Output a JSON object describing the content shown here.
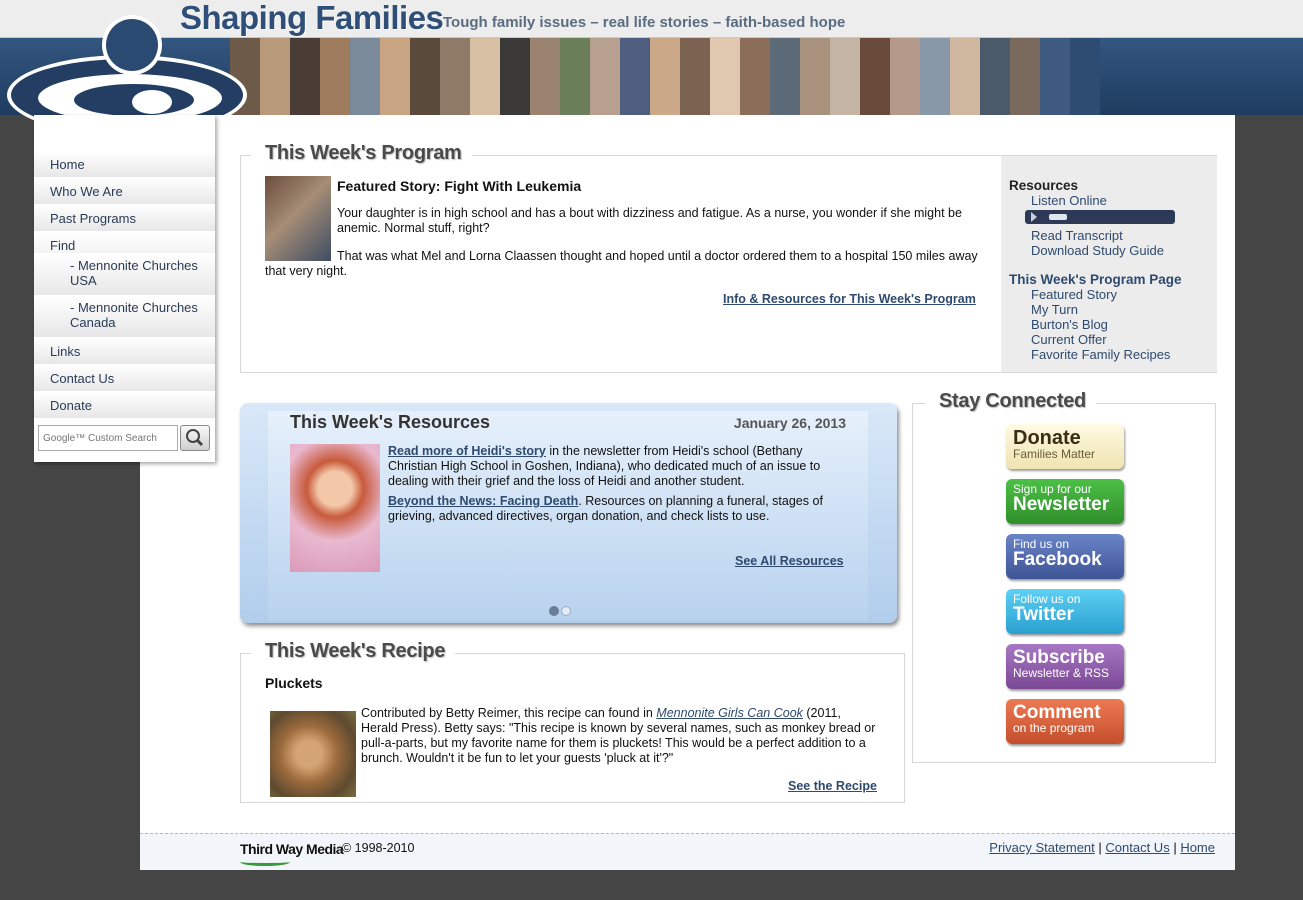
{
  "header": {
    "site_title": "Shaping Families",
    "tagline": "Tough family issues – real life stories – faith-based hope"
  },
  "nav": {
    "items": [
      "Home",
      "Who We Are",
      "Past Programs",
      "Find"
    ],
    "find_sub": [
      "- Mennonite Churches USA",
      "- Mennonite Churches Canada"
    ],
    "items_after": [
      "Links",
      "Contact Us",
      "Donate"
    ],
    "search_placeholder": "Google™ Custom Search"
  },
  "program": {
    "legend": "This Week's Program",
    "featured_heading": "Featured Story: Fight With Leukemia",
    "p1": "Your daughter is in high school and has a bout with dizziness and fatigue. As a nurse, you wonder if she might be anemic. Normal stuff, right?",
    "p2": "That was what Mel and Lorna Claassen thought and hoped until a doctor ordered them to a hospital 150 miles away that very night.",
    "link": "Info & Resources for This Week's Program",
    "resources_title": "Resources",
    "listen_online": "Listen Online",
    "read_transcript": "Read Transcript",
    "download_study_guide": "Download Study Guide",
    "page_title": "This Week's Program Page",
    "page_links": [
      "Featured Story",
      "My Turn",
      "Burton's Blog",
      "Current Offer",
      "Favorite Family Recipes"
    ]
  },
  "resources": {
    "title": "This Week's Resources",
    "date": "January 26, 2013",
    "link1": "Read more of Heidi's story",
    "text1": " in the newsletter from Heidi's school (Bethany Christian High School in Goshen, Indiana), who dedicated much of an issue to dealing with their grief and the loss of Heidi and another student.",
    "link2": "Beyond the News: Facing Death",
    "text2": ". Resources on planning a funeral, stages of grieving, advanced directives, organ donation, and check lists to use.",
    "see_all": "See All Resources",
    "active_slide": 1,
    "slide_count": 2
  },
  "recipe": {
    "legend": "This Week's Recipe",
    "name": "Pluckets",
    "text_before": "Contributed by Betty Reimer, this recipe can found in ",
    "book": "Mennonite Girls Can Cook",
    "text_after": " (2011, Herald Press). Betty says: \"This recipe is known by several names, such as monkey bread or pull-a-parts, but my favorite name for them is pluckets! This would be a perfect addition to a brunch. Wouldn't it be fun to let your guests 'pluck at it'?\"",
    "link": "See the Recipe"
  },
  "connected": {
    "legend": "Stay Connected",
    "buttons": [
      {
        "big": "Donate",
        "small": "Families Matter",
        "color": "#f6efc8",
        "text_color": "#4a3a1a"
      },
      {
        "small": "Sign up for our",
        "big": "Newsletter",
        "color": "#3fa33a"
      },
      {
        "small": "Find us on",
        "big": "Facebook",
        "color": "#4b64a6"
      },
      {
        "small": "Follow us on",
        "big": "Twitter",
        "color": "#3bb7e4"
      },
      {
        "big": "Subscribe",
        "small": "Newsletter & RSS",
        "color": "#8d5ba6"
      },
      {
        "big": "Comment",
        "small": "on the program",
        "color": "#d9603d"
      }
    ]
  },
  "footer": {
    "logo_text": "Third Way Media",
    "copyright": "© 1998-2010",
    "links": [
      "Privacy Statement",
      "Contact Us",
      "Home"
    ]
  }
}
